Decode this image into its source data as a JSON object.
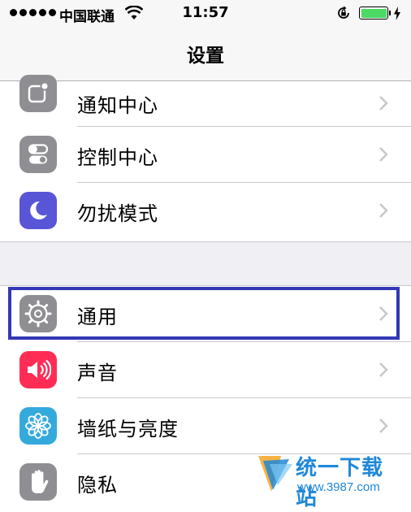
{
  "status_bar": {
    "carrier": "中国联通",
    "time": "11:57"
  },
  "nav": {
    "title": "设置"
  },
  "group_a": [
    {
      "label": "通知中心",
      "icon": "notification-center-icon",
      "color": "#8e8e93"
    },
    {
      "label": "控制中心",
      "icon": "control-center-icon",
      "color": "#8e8e93"
    },
    {
      "label": "勿扰模式",
      "icon": "moon-icon",
      "color": "#5856d6"
    }
  ],
  "group_b": [
    {
      "label": "通用",
      "icon": "gear-icon",
      "color": "#8e8e93"
    },
    {
      "label": "声音",
      "icon": "speaker-icon",
      "color": "#ff2d55"
    },
    {
      "label": "墙纸与亮度",
      "icon": "flower-icon",
      "color": "#34aadc"
    },
    {
      "label": "隐私",
      "icon": "hand-icon",
      "color": "#8e8e93"
    }
  ],
  "watermark": {
    "title": "统一下载站",
    "url": "www.3987.com"
  }
}
